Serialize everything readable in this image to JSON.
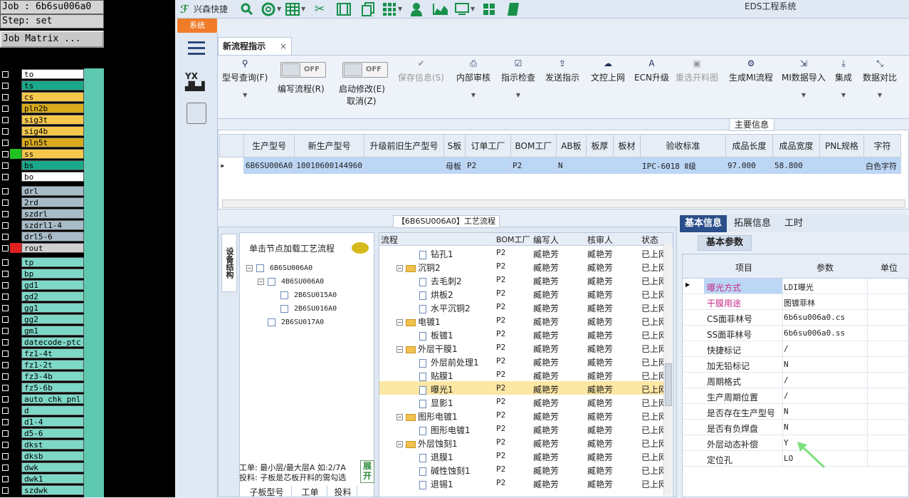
{
  "job": {
    "job_line": "Job : 6b6su006a0",
    "step_line": "Step: set",
    "matrix_button": "Job Matrix ..."
  },
  "matrix_layers": [
    {
      "name": "to",
      "color": "#ffffff"
    },
    {
      "name": "ts",
      "color": "#1aa88a"
    },
    {
      "name": "cs",
      "color": "#f5c84c"
    },
    {
      "name": "pln2b",
      "color": "#d8aa1c"
    },
    {
      "name": "sig3t",
      "color": "#f5c84c"
    },
    {
      "name": "sig4b",
      "color": "#f5c84c"
    },
    {
      "name": "pln5t",
      "color": "#d8aa1c"
    },
    {
      "name": "ss",
      "color": "#f5c84c",
      "swatch": "#20c020"
    },
    {
      "name": "bs",
      "color": "#1aa88a"
    },
    {
      "name": "bo",
      "color": "#ffffff"
    },
    {
      "name": "drl",
      "color": "#a8bcc8"
    },
    {
      "name": "2rd",
      "color": "#a8bcc8"
    },
    {
      "name": "szdrl",
      "color": "#a8bcc8"
    },
    {
      "name": "szdrl1-4",
      "color": "#a8bcc8"
    },
    {
      "name": "drl5-6",
      "color": "#a8bcc8"
    },
    {
      "name": "rout",
      "color": "#d0d0d0",
      "swatch": "#e02020"
    },
    {
      "name": "tp",
      "color": "#7ed8c8"
    },
    {
      "name": "bp",
      "color": "#7ed8c8"
    },
    {
      "name": "gd1",
      "color": "#7ed8c8"
    },
    {
      "name": "gd2",
      "color": "#7ed8c8"
    },
    {
      "name": "gg1",
      "color": "#7ed8c8"
    },
    {
      "name": "gg2",
      "color": "#7ed8c8"
    },
    {
      "name": "gm1",
      "color": "#7ed8c8"
    },
    {
      "name": "datecode-ptc",
      "color": "#7ed8c8"
    },
    {
      "name": "fz1-4t",
      "color": "#7ed8c8"
    },
    {
      "name": "fz1-2t",
      "color": "#7ed8c8"
    },
    {
      "name": "fz3-4b",
      "color": "#7ed8c8"
    },
    {
      "name": "fz5-6b",
      "color": "#7ed8c8"
    },
    {
      "name": "auto_chk_pnl",
      "color": "#7ed8c8"
    },
    {
      "name": "d",
      "color": "#7ed8c8"
    },
    {
      "name": "d1-4",
      "color": "#7ed8c8"
    },
    {
      "name": "d5-6",
      "color": "#7ed8c8"
    },
    {
      "name": "dkst",
      "color": "#7ed8c8"
    },
    {
      "name": "dksb",
      "color": "#7ed8c8"
    },
    {
      "name": "dwk",
      "color": "#7ed8c8"
    },
    {
      "name": "dwk1",
      "color": "#7ed8c8"
    },
    {
      "name": "szdwk",
      "color": "#7ed8c8"
    }
  ],
  "app": {
    "name": "兴森快捷",
    "system_title": "EDS工程系统",
    "system_tab": "系统"
  },
  "toolbar_icons": [
    "search-icon",
    "lifebuoy-icon",
    "table-icon",
    "scissors-icon",
    "film-icon",
    "copy-icon",
    "grid-icon",
    "user-icon",
    "area-chart-icon",
    "monitor-icon",
    "windows-icon",
    "book-icon"
  ],
  "doc_tab": {
    "label": "新流程指示",
    "close": "×"
  },
  "ribbon": {
    "model_query": "型号查询(F)",
    "toggle_off": "OFF",
    "edit_flow": "编写流程(R)",
    "start_modify": "启动修改(E)",
    "cancel": "取消(Z)",
    "save_info": "保存信息(S)",
    "internal_review": "内部审核",
    "instruction_check": "指示检查",
    "send_instruction": "发送指示",
    "upload_online": "文控上网",
    "ecn_upgrade": "ECN升级",
    "reselect_cut": "重选开料图",
    "generate_mi": "生成MI流程",
    "mi_import": "MI数据导入",
    "integrate": "集成",
    "data_compare": "数据对比"
  },
  "main_info": {
    "label": "主要信息",
    "headers": [
      "生产型号",
      "新生产型号",
      "升级前旧生产型号",
      "S板",
      "订单工厂",
      "BOM工厂",
      "AB板",
      "板厚",
      "板材",
      "验收标准",
      "成品长度",
      "成品宽度",
      "PNL规格",
      "字符"
    ],
    "row": [
      "6B6SU006A0",
      "10010600144960",
      "",
      "母板",
      "P2",
      "P2",
      "N",
      "",
      "",
      "IPC-6018 Ⅱ级",
      "97.000",
      "58.800",
      "",
      "白色字符"
    ]
  },
  "process": {
    "title": "【6B6SU006A0】工艺流程",
    "side_tab": "设备结构",
    "tree_hint": "单击节点加载工艺流程",
    "tree": [
      {
        "label": "6B6SU006A0",
        "level": 0,
        "expand": "⊟"
      },
      {
        "label": "4B6SU006A0",
        "level": 1,
        "expand": "⊟"
      },
      {
        "label": "2B6SU015A0",
        "level": 2,
        "expand": ""
      },
      {
        "label": "2B6SU016A0",
        "level": 2,
        "expand": ""
      },
      {
        "label": "2B6SU017A0",
        "level": 1,
        "expand": ""
      }
    ],
    "info_line1": "工单: 最小层/最大层A 如:2/7A",
    "info_line2": "投料: 子板是芯板开料的需勾选",
    "expand_btn": "展开",
    "bottom_tabs": [
      "子板型号",
      "工单",
      "投料"
    ],
    "flow_headers": [
      "流程",
      "BOM工厂",
      "编写人",
      "核审人",
      "状态"
    ],
    "flow_rows": [
      {
        "name": "钻孔1",
        "type": "doc",
        "factory": "P2",
        "writer": "臧艳芳",
        "reviewer": "臧艳芳",
        "status": "已上网"
      },
      {
        "name": "沉铜2",
        "type": "folder",
        "factory": "P2",
        "writer": "臧艳芳",
        "reviewer": "臧艳芳",
        "status": "已上网"
      },
      {
        "name": "去毛刺2",
        "type": "doc",
        "factory": "P2",
        "writer": "臧艳芳",
        "reviewer": "臧艳芳",
        "status": "已上网"
      },
      {
        "name": "烘板2",
        "type": "doc",
        "factory": "P2",
        "writer": "臧艳芳",
        "reviewer": "臧艳芳",
        "status": "已上网"
      },
      {
        "name": "水平沉铜2",
        "type": "doc",
        "factory": "P2",
        "writer": "臧艳芳",
        "reviewer": "臧艳芳",
        "status": "已上网"
      },
      {
        "name": "电镀1",
        "type": "folder",
        "factory": "P2",
        "writer": "臧艳芳",
        "reviewer": "臧艳芳",
        "status": "已上网"
      },
      {
        "name": "板镀1",
        "type": "doc",
        "factory": "P2",
        "writer": "臧艳芳",
        "reviewer": "臧艳芳",
        "status": "已上网"
      },
      {
        "name": "外层干膜1",
        "type": "folder",
        "factory": "P2",
        "writer": "臧艳芳",
        "reviewer": "臧艳芳",
        "status": "已上网"
      },
      {
        "name": "外层前处理1",
        "type": "doc",
        "factory": "P2",
        "writer": "臧艳芳",
        "reviewer": "臧艳芳",
        "status": "已上网"
      },
      {
        "name": "贴膜1",
        "type": "doc",
        "factory": "P2",
        "writer": "臧艳芳",
        "reviewer": "臧艳芳",
        "status": "已上网"
      },
      {
        "name": "曝光1",
        "type": "doc",
        "factory": "P2",
        "writer": "臧艳芳",
        "reviewer": "臧艳芳",
        "status": "已上网",
        "selected": true
      },
      {
        "name": "显影1",
        "type": "doc",
        "factory": "P2",
        "writer": "臧艳芳",
        "reviewer": "臧艳芳",
        "status": "已上网"
      },
      {
        "name": "图形电镀1",
        "type": "folder",
        "factory": "P2",
        "writer": "臧艳芳",
        "reviewer": "臧艳芳",
        "status": "已上网"
      },
      {
        "name": "图形电镀1",
        "type": "doc",
        "factory": "P2",
        "writer": "臧艳芳",
        "reviewer": "臧艳芳",
        "status": "已上网"
      },
      {
        "name": "外层蚀刻1",
        "type": "folder",
        "factory": "P2",
        "writer": "臧艳芳",
        "reviewer": "臧艳芳",
        "status": "已上网"
      },
      {
        "name": "退膜1",
        "type": "doc",
        "factory": "P2",
        "writer": "臧艳芳",
        "reviewer": "臧艳芳",
        "status": "已上网"
      },
      {
        "name": "碱性蚀刻1",
        "type": "doc",
        "factory": "P2",
        "writer": "臧艳芳",
        "reviewer": "臧艳芳",
        "status": "已上网"
      },
      {
        "name": "退锡1",
        "type": "doc",
        "factory": "P2",
        "writer": "臧艳芳",
        "reviewer": "臧艳芳",
        "status": "已上网"
      }
    ]
  },
  "props": {
    "tabs": [
      "基本信息",
      "拓展信息",
      "工时"
    ],
    "subtab": "基本参数",
    "headers": [
      "项目",
      "参数",
      "单位"
    ],
    "rows": [
      {
        "k": "曝光方式",
        "v": "LDI曝光",
        "pink": true,
        "active": true
      },
      {
        "k": "干膜用途",
        "v": "图镀菲林",
        "pink": true
      },
      {
        "k": "CS面菲林号",
        "v": "6b6su006a0.cs"
      },
      {
        "k": "SS面菲林号",
        "v": "6b6su006a0.ss"
      },
      {
        "k": "快捷标记",
        "v": "/"
      },
      {
        "k": "加无铅标记",
        "v": "N"
      },
      {
        "k": "周期格式",
        "v": "/"
      },
      {
        "k": "生产周期位置",
        "v": "/"
      },
      {
        "k": "是否存在生产型号",
        "v": "N"
      },
      {
        "k": "是否有负焊盘",
        "v": "N"
      },
      {
        "k": "外层动态补偿",
        "v": "Y"
      },
      {
        "k": "定位孔",
        "v": "LO"
      }
    ]
  }
}
